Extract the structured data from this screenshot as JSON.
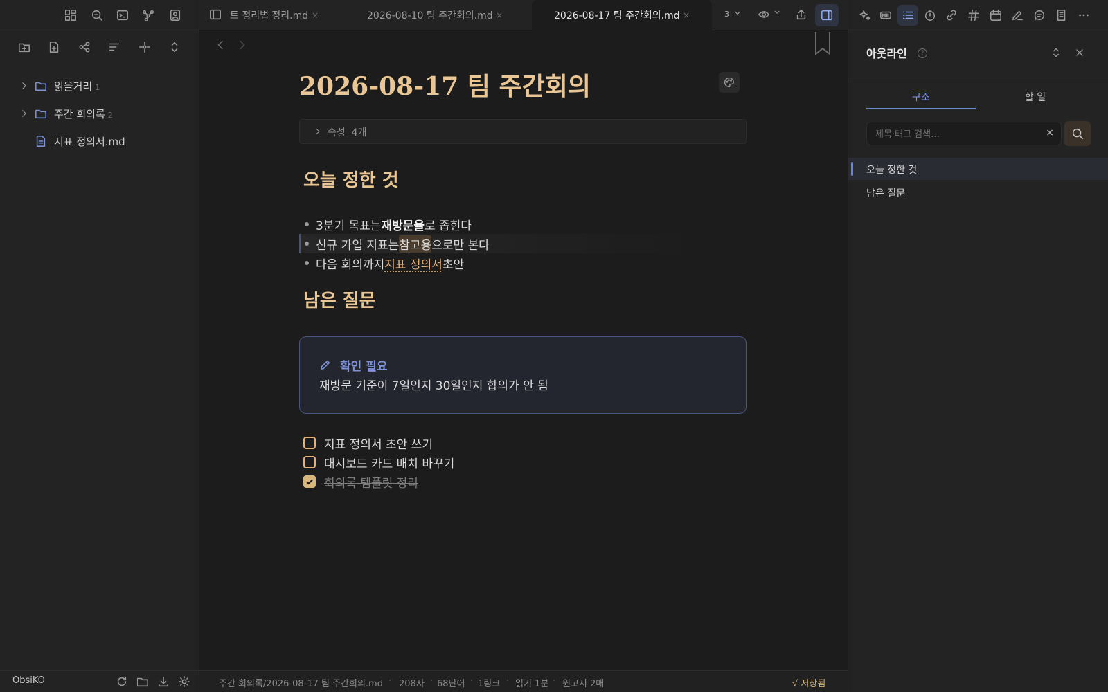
{
  "vault_name": "ObsiKO",
  "file_tree": [
    {
      "label": "읽을거리",
      "count": "1",
      "type": "folder"
    },
    {
      "label": "주간 회의록",
      "count": "2",
      "type": "folder"
    },
    {
      "label": "지표 정의서.md",
      "count": "",
      "type": "file"
    }
  ],
  "tabs": [
    {
      "label": "트 정리법 정리.md",
      "active": false
    },
    {
      "label": "2026-08-10 팀 주간회의.md",
      "active": false
    },
    {
      "label": "2026-08-17 팀 주간회의.md",
      "active": true
    }
  ],
  "tab_close_glyph": "×",
  "tab_count": "3",
  "note": {
    "title": "2026-08-17 팀 주간회의",
    "properties_label": "속성",
    "properties_count": "4개",
    "section1": "오늘 정한 것",
    "bullets": [
      {
        "pre": "3분기 목표는 ",
        "bold": "재방문율",
        "post": "로 좁힌다"
      },
      {
        "pre": "신규 가입 지표는 ",
        "highlight": "참고용",
        "post": "으로만 본다"
      },
      {
        "pre": "다음 회의까지 ",
        "link": "지표 정의서",
        "post": " 초안"
      }
    ],
    "section2": "남은 질문",
    "callout": {
      "title": "확인 필요",
      "body": "재방문 기준이 7일인지 30일인지 합의가 안 됨"
    },
    "tasks": [
      {
        "label": "지표 정의서 초안 쓰기",
        "done": false
      },
      {
        "label": "대시보드 카드 배치 바꾸기",
        "done": false
      },
      {
        "label": "회의록 템플릿 정리",
        "done": true
      }
    ]
  },
  "status_bar": {
    "path": "주간 회의록/2026-08-17 팀 주간회의.md",
    "chars": "208자",
    "words": "68단어",
    "links": "1링크",
    "read_time": "읽기 1분",
    "manuscript": "원고지 2매",
    "saved": "√ 저장됨",
    "separator": "·"
  },
  "outline_panel": {
    "title": "아웃라인",
    "help_glyph": "?",
    "tabs": [
      {
        "label": "구조",
        "active": true
      },
      {
        "label": "할 일",
        "active": false
      }
    ],
    "search_placeholder": "제목·태그 검색…",
    "search_value": "",
    "clear_glyph": "×",
    "items": [
      {
        "label": "오늘 정한 것",
        "active": true
      },
      {
        "label": "남은 질문",
        "active": false
      }
    ]
  },
  "colors": {
    "heading": "#e9c693",
    "accent_blue": "#6c86d3",
    "link": "#e0b07d",
    "background": "#1c1c1c",
    "sidebar": "#232323"
  },
  "icons": {
    "left_top": [
      "layout-icon",
      "search-replace-icon",
      "terminal-icon",
      "graph-icon",
      "contact-icon"
    ],
    "left_tools": [
      "new-folder-icon",
      "new-note-icon",
      "graph-tree-icon",
      "sort-icon",
      "focus-icon",
      "expand-collapse-icon"
    ],
    "right_top": [
      "sparkle-icon",
      "template-icon",
      "outline-icon",
      "timer-icon",
      "link-icon",
      "hashtag-icon",
      "calendar-icon",
      "pen-icon",
      "chat-icon",
      "book-icon",
      "more-icon"
    ],
    "left_bottom": [
      "refresh-icon",
      "folder-icon",
      "download-icon",
      "settings-icon"
    ]
  }
}
